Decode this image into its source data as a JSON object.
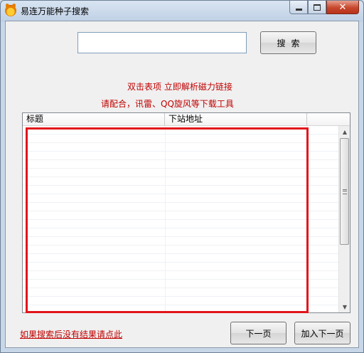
{
  "window": {
    "title": "易连万能种子搜索",
    "controls": {
      "minimize": "minimize",
      "maximize": "maximize",
      "close": "✕"
    }
  },
  "search": {
    "value": "",
    "placeholder": "",
    "button_label": "搜索"
  },
  "hints": {
    "line1": "双击表项 立即解析磁力链接",
    "line2": "请配合，讯雷、QQ旋风等下载工具"
  },
  "table": {
    "columns": [
      "标题",
      "下站地址"
    ],
    "rows": []
  },
  "footer": {
    "link_text": "如果搜索后没有结果请点此",
    "next_label": "下一页",
    "add_next_label": "加入下一页"
  },
  "colors": {
    "accent_red": "#c00000",
    "highlight_border": "#e2151a"
  },
  "icons": {
    "app": "app-logo-icon",
    "scroll_up": "chevron-up-icon",
    "scroll_down": "chevron-down-icon"
  }
}
